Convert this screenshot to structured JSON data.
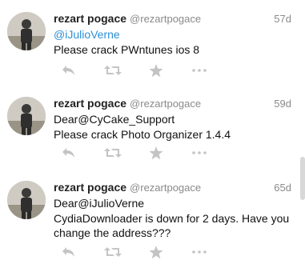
{
  "tweets": [
    {
      "name": "rezart pogace",
      "handle": "@rezartpogace",
      "time": "57d",
      "lines": [
        {
          "text": "@iJulioVerne",
          "mention": true
        },
        {
          "text": "Please crack PWntunes ios 8",
          "mention": false
        }
      ]
    },
    {
      "name": "rezart pogace",
      "handle": "@rezartpogace",
      "time": "59d",
      "lines": [
        {
          "text": "Dear@CyCake_Support",
          "mention": false
        },
        {
          "text": "Please crack Photo Organizer 1.4.4",
          "mention": false
        }
      ]
    },
    {
      "name": "rezart pogace",
      "handle": "@rezartpogace",
      "time": "65d",
      "lines": [
        {
          "text": "Dear@iJulioVerne",
          "mention": false
        },
        {
          "text": "CydiaDownloader is down for 2 days. Have you",
          "mention": false
        },
        {
          "text": "change the address???",
          "mention": false
        }
      ]
    }
  ],
  "actions": [
    "reply-icon",
    "retweet-icon",
    "favorite-icon",
    "more-icon"
  ],
  "colors": {
    "mention": "#2b8fd6",
    "icon": "#c4c4c4",
    "meta": "#8a8a8a"
  }
}
